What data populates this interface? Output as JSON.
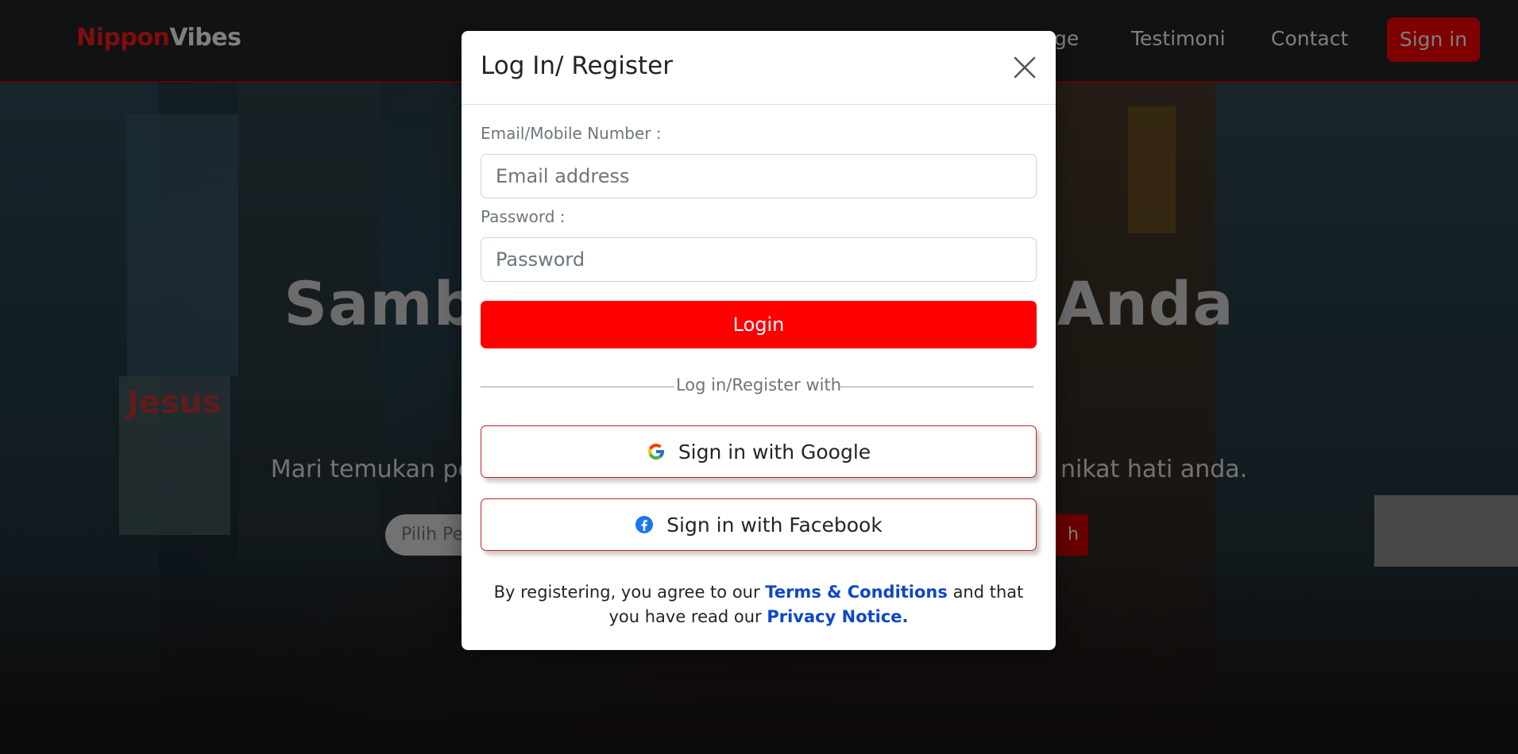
{
  "navbar": {
    "brand_part1": "Nippon",
    "brand_part2": "Vibes",
    "links": [
      "ge",
      "Testimoni",
      "Contact"
    ],
    "signin_label": "Sign in"
  },
  "hero": {
    "title_left": "Samb",
    "title_right": "Anda",
    "subtitle_left": "Mari temukan pe",
    "subtitle_right": "nikat hati anda.",
    "search_placeholder": "Pilih Pe",
    "search_button": "h"
  },
  "modal": {
    "title": "Log In/ Register",
    "email_label": "Email/Mobile Number :",
    "email_placeholder": "Email address",
    "password_label": "Password :",
    "password_placeholder": "Password",
    "login_label": "Login",
    "divider_text": "Log in/Register with",
    "google_label": "Sign in with Google",
    "facebook_label": "Sign in with Facebook",
    "terms_prefix": "By registering, you agree to our ",
    "terms_link": "Terms & Conditions",
    "terms_middle": " and that you have read our ",
    "privacy_link": "Privacy Notice."
  },
  "icons": {
    "close": "close-icon",
    "google": "google-icon",
    "facebook": "facebook-icon"
  },
  "colors": {
    "accent": "#ff0000",
    "navbar_bg": "#212529",
    "link": "#0d47c9"
  }
}
